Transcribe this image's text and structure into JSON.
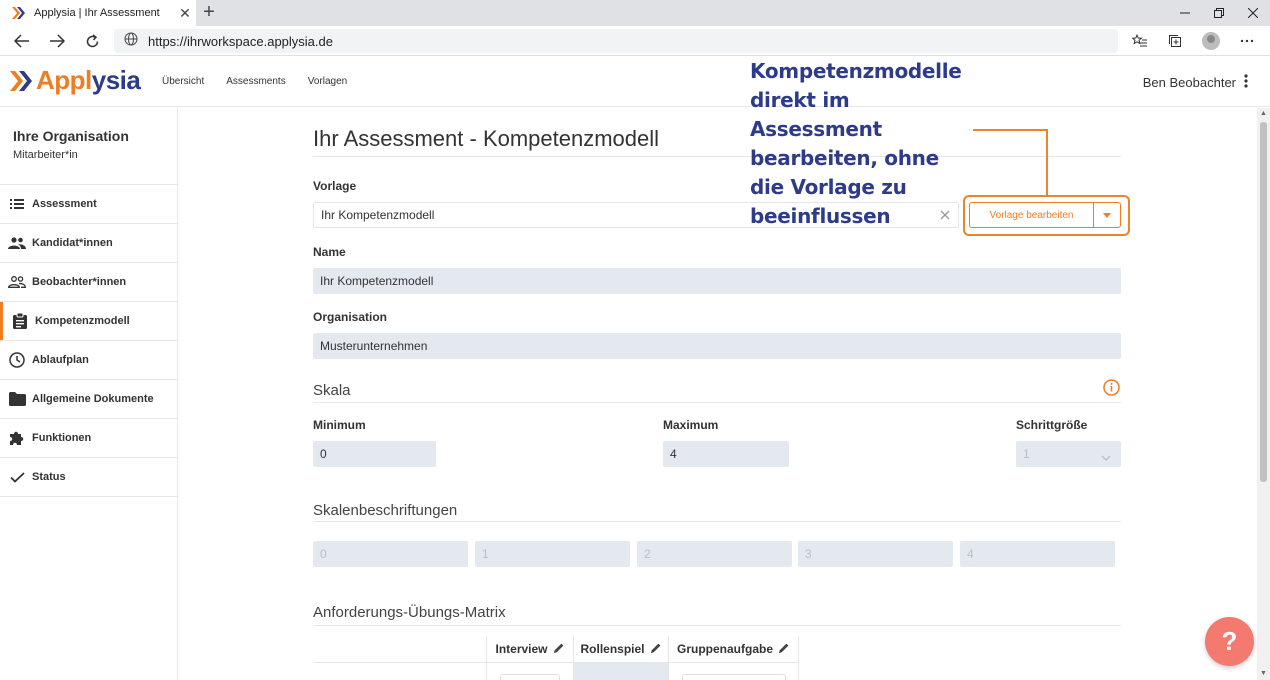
{
  "browser": {
    "tab_title": "Applysia | Ihr Assessment",
    "tab_close": "✕",
    "new_tab": "+",
    "url": "https://ihrworkspace.applysia.de"
  },
  "app": {
    "logo_text_orange": "Appl",
    "logo_text_blue": "ysia",
    "nav": [
      "Übersicht",
      "Assessments",
      "Vorlagen"
    ],
    "user_name": "Ben Beobachter"
  },
  "sidebar": {
    "org_name": "Ihre Organisation",
    "org_role": "Mitarbeiter*in",
    "items": [
      {
        "label": "Assessment",
        "icon": "list-icon"
      },
      {
        "label": "Kandidat*innen",
        "icon": "people-icon"
      },
      {
        "label": "Beobachter*innen",
        "icon": "people-outline-icon"
      },
      {
        "label": "Kompetenzmodell",
        "icon": "clipboard-icon",
        "active": true
      },
      {
        "label": "Ablaufplan",
        "icon": "clock-icon"
      },
      {
        "label": "Allgemeine Dokumente",
        "icon": "folder-icon"
      },
      {
        "label": "Funktionen",
        "icon": "puzzle-icon"
      },
      {
        "label": "Status",
        "icon": "check-icon"
      }
    ]
  },
  "main": {
    "title": "Ihr Assessment - Kompetenzmodell",
    "vorlage_label": "Vorlage",
    "vorlage_value": "Ihr Kompetenzmodell",
    "vorlage_button": "Vorlage bearbeiten",
    "name_label": "Name",
    "name_value": "Ihr Kompetenzmodell",
    "org_label": "Organisation",
    "org_value": "Musterunternehmen",
    "skala_title": "Skala",
    "min_label": "Minimum",
    "min_value": "0",
    "max_label": "Maximum",
    "max_value": "4",
    "step_label": "Schrittgröße",
    "step_value": "1",
    "labels_title": "Skalenbeschriftungen",
    "scale_labels": [
      "0",
      "1",
      "2",
      "3",
      "4"
    ],
    "matrix_title": "Anforderungs-Übungs-Matrix",
    "matrix_columns": [
      "Interview",
      "Rollenspiel",
      "Gruppenaufgabe"
    ]
  },
  "annotation": {
    "lines": [
      "Kompetenzmodelle",
      "direkt im",
      "Assessment",
      "bearbeiten, ohne",
      "die Vorlage zu",
      "beeinflussen"
    ]
  },
  "help": {
    "label": "?"
  },
  "colors": {
    "brand_orange": "#f07d22",
    "brand_blue": "#2d3b8a",
    "help_red": "#f47a70"
  }
}
